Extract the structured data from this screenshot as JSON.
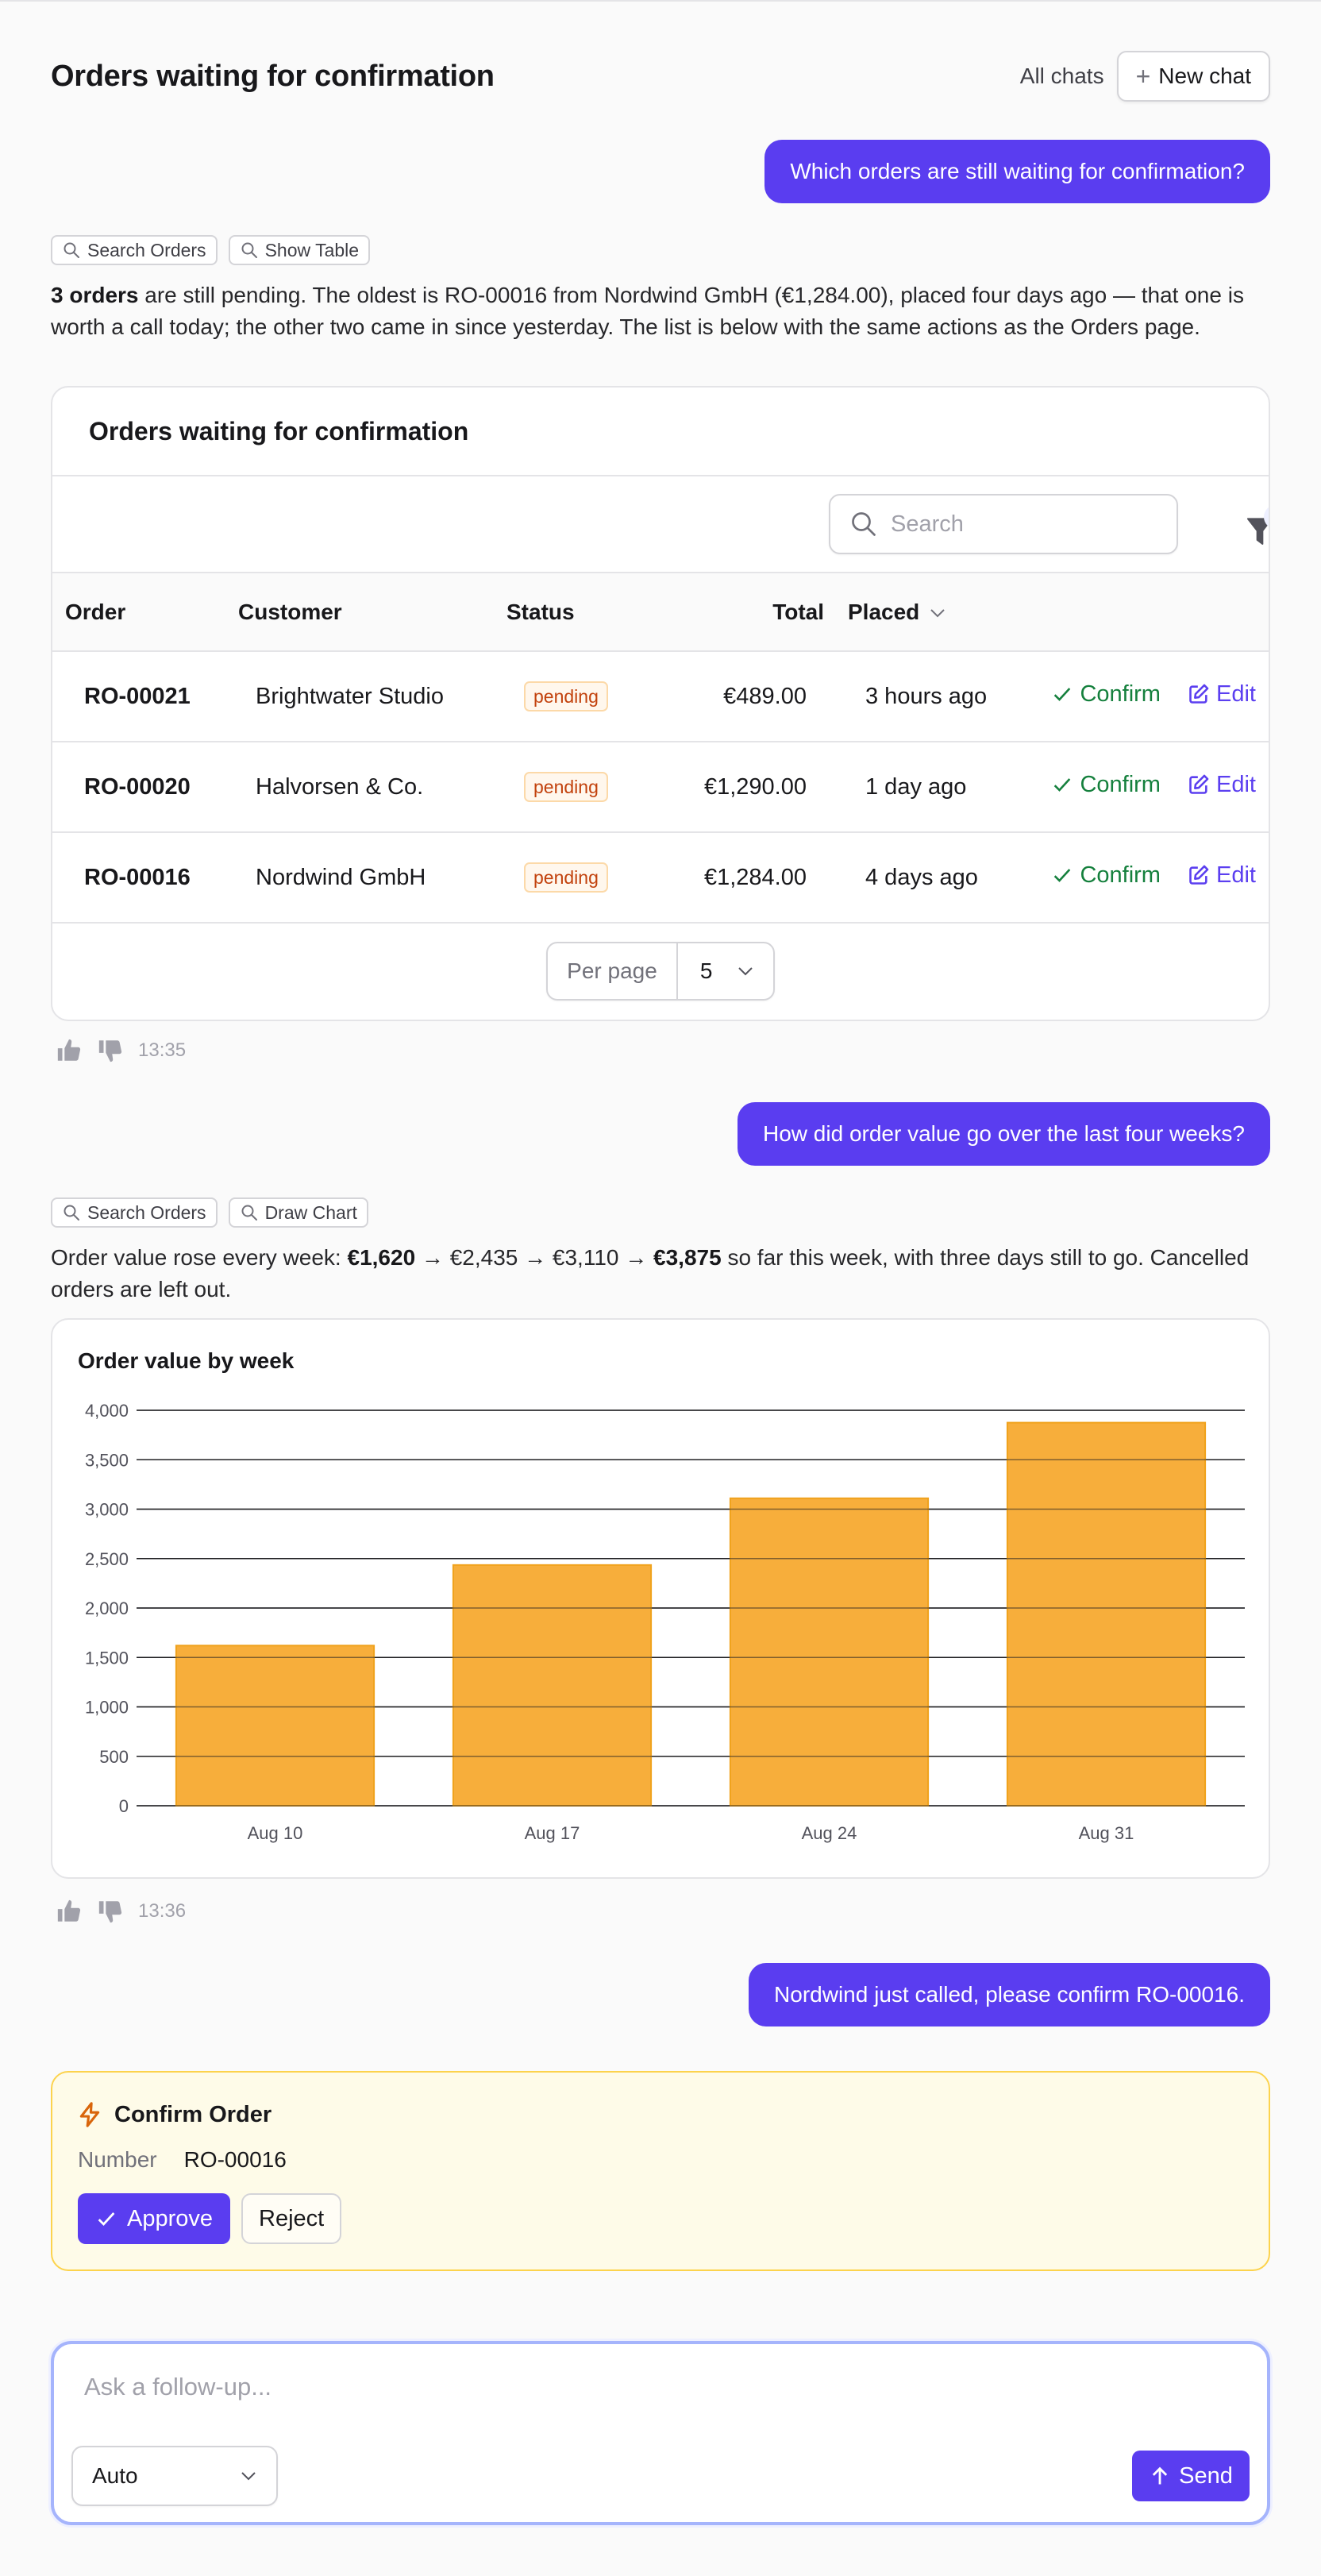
{
  "header": {
    "title": "Orders waiting for confirmation",
    "all_chats": "All chats",
    "new_chat": "New chat"
  },
  "conversation": {
    "q1": "Which orders are still waiting for confirmation?",
    "tools1": [
      "Search Orders",
      "Show Table"
    ],
    "a1": {
      "strong": "3 orders",
      "rest": " are still pending. The oldest is RO-00016 from Nordwind GmbH (€1,284.00), placed four days ago — that one is worth a call today; the other two came in since yesterday. The list is below with the same actions as the Orders page."
    },
    "time1": "13:35",
    "q2": "How did order value go over the last four weeks?",
    "tools2": [
      "Search Orders",
      "Draw Chart"
    ],
    "a2": {
      "t1": "Order value rose every week: ",
      "b1": "€1,620",
      "t2": " → €2,435 → €3,110 → ",
      "b2": "€3,875",
      "t3": " so far this week, with three days still to go. Cancelled orders are left out."
    },
    "time2": "13:36",
    "q3": "Nordwind just called, please confirm RO-00016."
  },
  "orders_table": {
    "title": "Orders waiting for confirmation",
    "search_placeholder": "Search",
    "filter_count": "0",
    "columns": [
      "Order",
      "Customer",
      "Status",
      "Total",
      "Placed"
    ],
    "rows": [
      {
        "order": "RO-00021",
        "customer": "Brightwater Studio",
        "status": "pending",
        "total": "€489.00",
        "placed": "3 hours ago"
      },
      {
        "order": "RO-00020",
        "customer": "Halvorsen & Co.",
        "status": "pending",
        "total": "€1,290.00",
        "placed": "1 day ago"
      },
      {
        "order": "RO-00016",
        "customer": "Nordwind GmbH",
        "status": "pending",
        "total": "€1,284.00",
        "placed": "4 days ago"
      }
    ],
    "confirm_label": "Confirm",
    "edit_label": "Edit",
    "per_page_label": "Per page",
    "per_page_value": "5"
  },
  "chart_data": {
    "type": "bar",
    "title": "Order value by week",
    "categories": [
      "Aug 10",
      "Aug 17",
      "Aug 24",
      "Aug 31"
    ],
    "values": [
      1620,
      2435,
      3110,
      3875
    ],
    "ylim": [
      0,
      4000
    ],
    "yticks": [
      0,
      500,
      1000,
      1500,
      2000,
      2500,
      3000,
      3500,
      4000
    ],
    "ytick_labels": [
      "0",
      "500",
      "1,000",
      "1,500",
      "2,000",
      "2,500",
      "3,000",
      "3,500",
      "4,000"
    ],
    "xlabel": "",
    "ylabel": "",
    "grid": true,
    "bar_color": "#f7ae3b",
    "bar_stroke": "#f0a21c"
  },
  "approval": {
    "title": "Confirm Order",
    "field_label": "Number",
    "field_value": "RO-00016",
    "approve": "Approve",
    "reject": "Reject"
  },
  "composer": {
    "placeholder": "Ask a follow-up...",
    "model": "Auto",
    "send": "Send"
  },
  "colors": {
    "accent": "#5a3df0",
    "confirm": "#15803d",
    "pending_text": "#c2410c",
    "approval_bg": "#fefbe8",
    "approval_border": "#fcd34d"
  }
}
